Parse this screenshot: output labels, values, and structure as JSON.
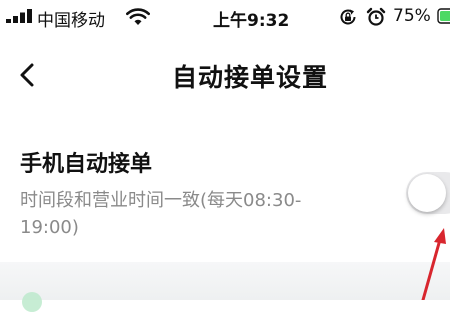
{
  "status_bar": {
    "carrier": "中国移动",
    "time": "上午9:32",
    "battery_percent": "75%",
    "battery_level": 0.75,
    "icons": [
      "signal-icon",
      "wifi-icon",
      "rotation-lock-icon",
      "alarm-icon",
      "battery-icon"
    ]
  },
  "nav": {
    "back_icon": "chevron-left-icon",
    "title": "自动接单设置"
  },
  "setting": {
    "title": "手机自动接单",
    "description": "时间段和营业时间一致(每天08:30-19:00)",
    "toggle_on": false
  },
  "colors": {
    "toggle_off": "#e9e9eb",
    "description": "#8a8a8a",
    "annotation": "#d8262e",
    "battery": "#4cd964"
  }
}
